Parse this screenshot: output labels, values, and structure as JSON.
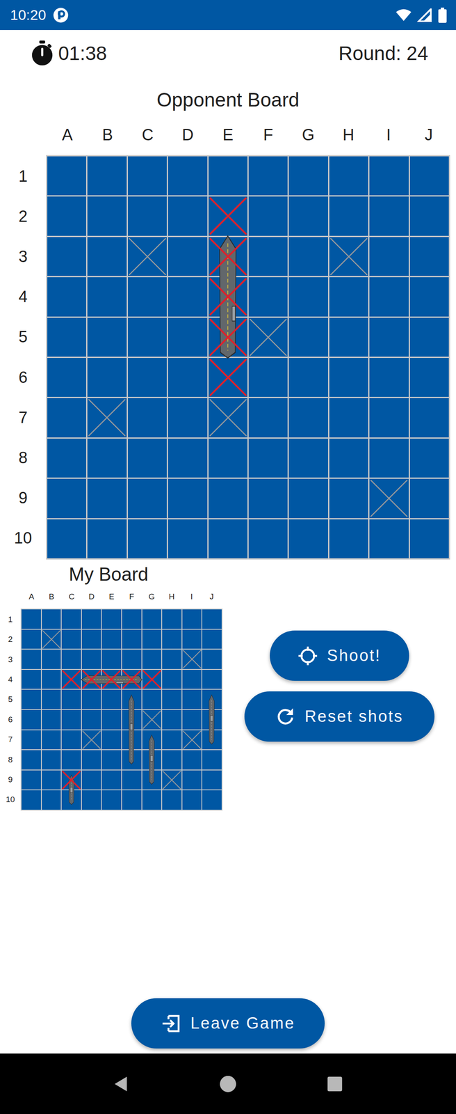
{
  "status_bar": {
    "time": "10:20"
  },
  "timer": "01:38",
  "round": "Round: 24",
  "opponent_board": {
    "title": "Opponent Board",
    "columns": [
      "A",
      "B",
      "C",
      "D",
      "E",
      "F",
      "G",
      "H",
      "I",
      "J"
    ],
    "rows": [
      "1",
      "2",
      "3",
      "4",
      "5",
      "6",
      "7",
      "8",
      "9",
      "10"
    ],
    "cells": [
      "..........",
      "....x.....",
      "..o.x..o..",
      "....x.....",
      "....xo....",
      "....x.....",
      ".o..o.....",
      "..........",
      "........o.",
      ".........."
    ],
    "ships": [
      {
        "kind": "carrier",
        "col": 4,
        "row": 1,
        "length": 5,
        "vertical": true
      }
    ]
  },
  "my_board": {
    "title": "My Board",
    "columns": [
      "A",
      "B",
      "C",
      "D",
      "E",
      "F",
      "G",
      "H",
      "I",
      "J"
    ],
    "rows": [
      "1",
      "2",
      "3",
      "4",
      "5",
      "6",
      "7",
      "8",
      "9",
      "10"
    ],
    "cells": [
      "..........",
      ".o........",
      "........o.",
      "..xxxxx...",
      "..........",
      "......o...",
      "...o....o.",
      "..........",
      "..x....o..",
      ".........."
    ],
    "ships": [
      {
        "kind": "carrier",
        "col": 2,
        "row": 3,
        "length": 5,
        "vertical": false
      },
      {
        "kind": "battleship",
        "col": 5,
        "row": 4,
        "length": 4,
        "vertical": true
      },
      {
        "kind": "submarine",
        "col": 6,
        "row": 6,
        "length": 3,
        "vertical": true
      },
      {
        "kind": "destroyer",
        "col": 9,
        "row": 4,
        "length": 3,
        "vertical": true
      },
      {
        "kind": "patrol",
        "col": 2,
        "row": 8,
        "length": 2,
        "vertical": true
      }
    ]
  },
  "shoot_button": "Shoot!",
  "reset_button": "Reset shots",
  "leave_button": "Leave Game"
}
